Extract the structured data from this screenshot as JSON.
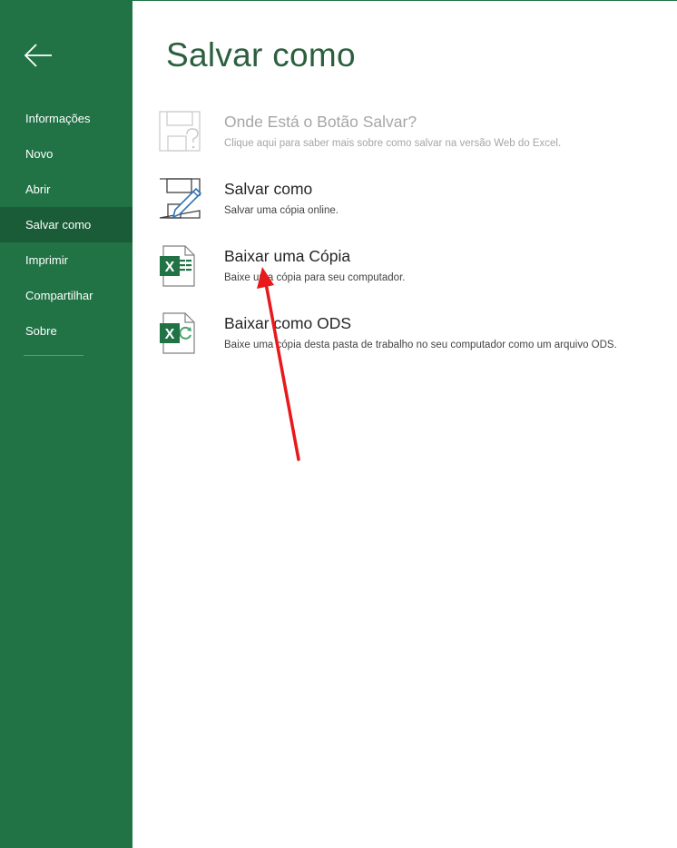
{
  "sidebar": {
    "back_icon": "back-arrow-icon",
    "items": [
      {
        "label": "Informações",
        "active": false
      },
      {
        "label": "Novo",
        "active": false
      },
      {
        "label": "Abrir",
        "active": false
      },
      {
        "label": "Salvar como",
        "active": true
      },
      {
        "label": "Imprimir",
        "active": false
      },
      {
        "label": "Compartilhar",
        "active": false
      },
      {
        "label": "Sobre",
        "active": false
      }
    ]
  },
  "main": {
    "title": "Salvar como",
    "options": [
      {
        "title": "Onde Está o Botão Salvar?",
        "description": "Clique aqui para saber mais sobre como salvar na versão Web do Excel.",
        "icon": "save-help-icon",
        "enabled": false
      },
      {
        "title": "Salvar como",
        "description": "Salvar uma cópia online.",
        "icon": "save-as-icon",
        "enabled": true
      },
      {
        "title": "Baixar uma Cópia",
        "description": "Baixe uma cópia para seu computador.",
        "icon": "excel-file-icon",
        "enabled": true
      },
      {
        "title": "Baixar como ODS",
        "description": "Baixe uma cópia desta pasta de trabalho no seu computador como um arquivo ODS.",
        "icon": "excel-ods-icon",
        "enabled": true
      }
    ]
  },
  "colors": {
    "sidebar_bg": "#217346",
    "sidebar_active": "#1a5c38",
    "title_green": "#2b5f3e",
    "annotation_arrow": "#e8191b"
  }
}
